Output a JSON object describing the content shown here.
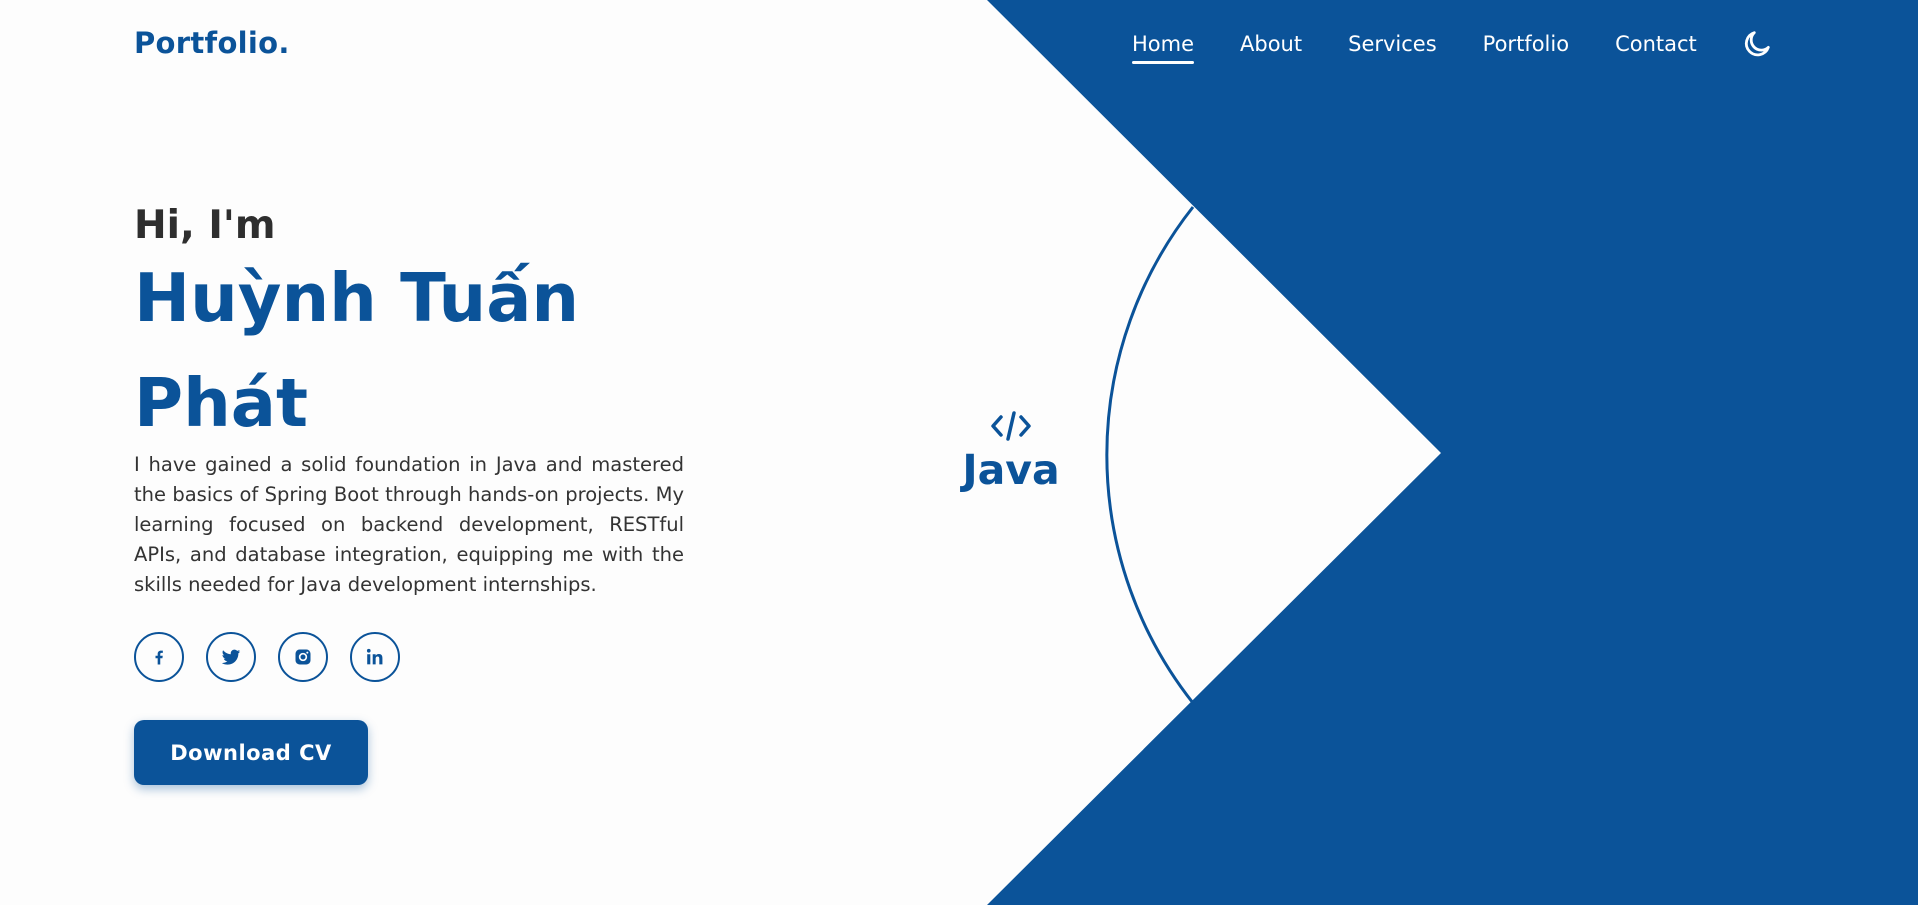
{
  "brand": {
    "logo_text": "Portfolio."
  },
  "nav": {
    "items": [
      {
        "label": "Home",
        "active": true
      },
      {
        "label": "About",
        "active": false
      },
      {
        "label": "Services",
        "active": false
      },
      {
        "label": "Portfolio",
        "active": false
      },
      {
        "label": "Contact",
        "active": false
      }
    ],
    "theme_toggle_icon": "moon-icon"
  },
  "hero": {
    "greeting": "Hi, I'm",
    "name": "Huỳnh Tuấn Phát",
    "description": "I have gained a solid foundation in Java and mastered the basics of Spring Boot through hands-on projects. My learning focused on backend development, RESTful APIs, and database integration, equipping me with the skills needed for Java development internships.",
    "socials": [
      {
        "icon": "facebook-icon"
      },
      {
        "icon": "twitter-icon"
      },
      {
        "icon": "instagram-icon"
      },
      {
        "icon": "linkedin-icon"
      }
    ],
    "cta_label": "Download CV"
  },
  "skill_badge": {
    "icon": "code-icon",
    "label": "Java"
  },
  "colors": {
    "primary": "#0b5399",
    "background": "#fdfdfd",
    "text_dark": "#2e2e2e",
    "text_body": "#333333"
  }
}
